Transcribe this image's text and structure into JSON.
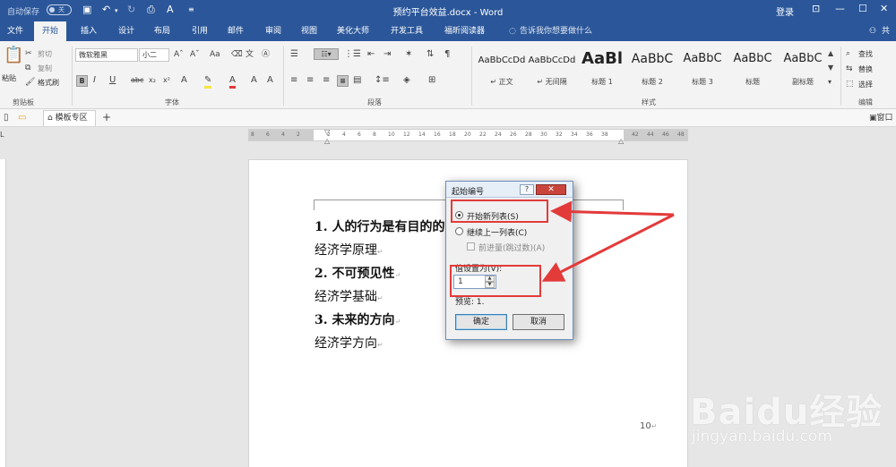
{
  "titlebar": {
    "autosave_label": "自动保存",
    "autosave_state": "关",
    "doc_title": "预约平台效益.docx - Word",
    "login": "登录",
    "controls": [
      "restore-icon",
      "minimize-icon",
      "maximize-icon",
      "close-icon"
    ]
  },
  "tabs": [
    {
      "label": "文件"
    },
    {
      "label": "开始"
    },
    {
      "label": "插入"
    },
    {
      "label": "设计"
    },
    {
      "label": "布局"
    },
    {
      "label": "引用"
    },
    {
      "label": "邮件"
    },
    {
      "label": "审阅"
    },
    {
      "label": "视图"
    },
    {
      "label": "美化大师"
    },
    {
      "label": "开发工具"
    },
    {
      "label": "福昕阅读器"
    }
  ],
  "active_tab": "开始",
  "tell_me": "告诉我你想要做什么",
  "share": "共享",
  "ribbon": {
    "clipboard": {
      "paste": "粘贴",
      "cut": "剪切",
      "copy": "复制",
      "format_painter": "格式刷",
      "label": "剪贴板"
    },
    "font": {
      "name": "微软雅黑",
      "size": "小二",
      "label": "字体",
      "case": "Aa"
    },
    "paragraph": {
      "label": "段落"
    },
    "styles": {
      "label": "样式",
      "items": [
        {
          "preview": "AaBbCcDd",
          "name": "↵ 正文"
        },
        {
          "preview": "AaBbCcDd",
          "name": "↵ 无间隔"
        },
        {
          "preview": "AaBl",
          "name": "标题 1"
        },
        {
          "preview": "AaBbC",
          "name": "标题 2"
        },
        {
          "preview": "AaBbC",
          "name": "标题 3"
        },
        {
          "preview": "AaBbC",
          "name": "标题"
        },
        {
          "preview": "AaBbC",
          "name": "副标题"
        }
      ]
    },
    "editing": {
      "find": "查找",
      "replace": "替换",
      "select": "选择",
      "label": "编辑"
    }
  },
  "template_strip": {
    "tab": "模板专区",
    "right": "窗口"
  },
  "ruler_ticks": [
    "8",
    "6",
    "4",
    "2",
    "",
    "2",
    "4",
    "6",
    "8",
    "10",
    "12",
    "14",
    "16",
    "18",
    "20",
    "22",
    "24",
    "26",
    "28",
    "30",
    "32",
    "34",
    "36",
    "38",
    "",
    "42",
    "44",
    "46",
    "48"
  ],
  "document": {
    "paragraphs": [
      {
        "text": "1. 人的行为是有目的的",
        "bold": true
      },
      {
        "text": "经济学原理",
        "bold": false
      },
      {
        "text": "2. 不可预见性",
        "bold": true
      },
      {
        "text": "经济学基础",
        "bold": false
      },
      {
        "text": "3. 未来的方向",
        "bold": true
      },
      {
        "text": "经济学方向",
        "bold": false
      }
    ],
    "paragraph_mark": "↵",
    "page_number": "10"
  },
  "dialog": {
    "title": "起始编号",
    "help": "?",
    "close": "✕",
    "option_new": "开始新列表(S)",
    "option_continue": "继续上一列表(C)",
    "option_advance": "前进量(跳过数)(A)",
    "set_value_label": "值设置为(V):",
    "value": "1",
    "preview": "预览: 1.",
    "ok": "确定",
    "cancel": "取消"
  },
  "colors": {
    "accent": "#2b579a",
    "annotation": "#e33a3a"
  },
  "watermark": {
    "brand": "Baidu经验",
    "site": "jingyan.baidu.com"
  }
}
